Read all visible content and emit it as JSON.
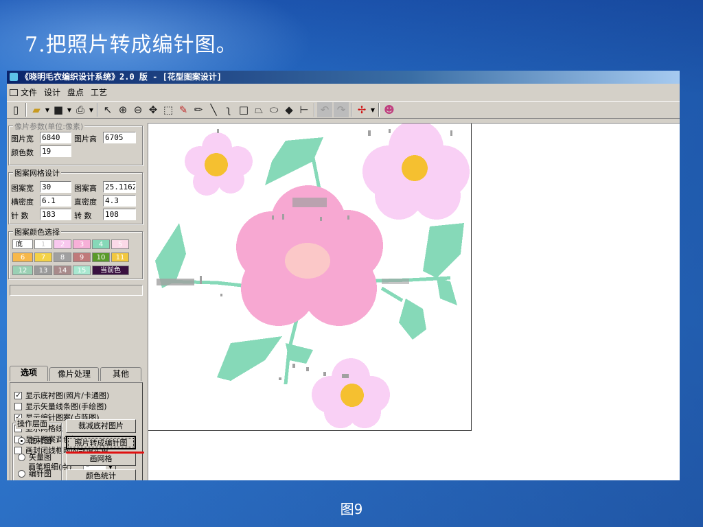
{
  "slide": {
    "title": "7.把照片转成编针图。",
    "caption": "图9"
  },
  "window": {
    "title": "《晓明毛衣编织设计系统》2.0 版 - [花型图案设计]",
    "menu": [
      "文件",
      "设计",
      "盘点",
      "工艺"
    ]
  },
  "toolbar": {
    "icons": [
      "new-icon",
      "open-icon",
      "save-icon",
      "print-icon",
      "pointer-icon",
      "zoom-in-icon",
      "zoom-out-icon",
      "move-icon",
      "select-rect-icon",
      "fill-icon",
      "pencil-icon",
      "line-icon",
      "curve-icon",
      "rect-icon",
      "polygon-icon",
      "ellipse-icon",
      "eraser-icon",
      "cross-icon",
      "undo-icon",
      "redo-icon",
      "mirror-icon",
      "person-icon"
    ]
  },
  "photo_params": {
    "group_title": "像片参数(单位:像素)",
    "width_label": "图片宽",
    "width_value": "6840",
    "height_label": "图片高",
    "height_value": "6705",
    "colors_label": "颜色数",
    "colors_value": "19"
  },
  "grid_design": {
    "group_title": "图案网格设计",
    "pattern_width_label": "图案宽",
    "pattern_width_value": "30",
    "pattern_height_label": "图案高",
    "pattern_height_value": "25.1162",
    "h_density_label": "横密度",
    "h_density_value": "6.1",
    "v_density_label": "直密度",
    "v_density_value": "4.3",
    "stitches_label": "针  数",
    "stitches_value": "183",
    "rows_label": "转  数",
    "rows_value": "108"
  },
  "color_select": {
    "group_title": "图案颜色选择",
    "base_label": "底",
    "swatches": [
      {
        "label": "1",
        "color": "#ffffff",
        "text": "#cccccc"
      },
      {
        "label": "2",
        "color": "#f9c8ef",
        "text": "#ffffff"
      },
      {
        "label": "3",
        "color": "#f7b0d8",
        "text": "#ffffff"
      },
      {
        "label": "4",
        "color": "#86d9b8",
        "text": "#ffffff"
      },
      {
        "label": "5",
        "color": "#fbd9e8",
        "text": "#ffffff"
      },
      {
        "label": "6",
        "color": "#f7b84a",
        "text": "#ffffff"
      },
      {
        "label": "7",
        "color": "#f4d246",
        "text": "#ffffff"
      },
      {
        "label": "8",
        "color": "#a0a0a0",
        "text": "#ffffff"
      },
      {
        "label": "9",
        "color": "#c07a7a",
        "text": "#ffffff"
      },
      {
        "label": "10",
        "color": "#5a9a2a",
        "text": "#ffffff"
      },
      {
        "label": "11",
        "color": "#f2c840",
        "text": "#ffffff"
      },
      {
        "label": "12",
        "color": "#9ad0b4",
        "text": "#ffffff"
      },
      {
        "label": "13",
        "color": "#9a9a9a",
        "text": "#ffffff"
      },
      {
        "label": "14",
        "color": "#a88a8a",
        "text": "#ffffff"
      },
      {
        "label": "15",
        "color": "#a8e8d0",
        "text": "#ffffff"
      }
    ],
    "current_label": "当前色",
    "current_color": "#3a1040"
  },
  "tabs": [
    {
      "label": "选项",
      "active": true
    },
    {
      "label": "像片处理",
      "active": false
    },
    {
      "label": "其他",
      "active": false
    }
  ],
  "options": [
    {
      "label": "显示底衬图(照片/卡通图)",
      "checked": true
    },
    {
      "label": "显示矢量线条图(手绘图)",
      "checked": false
    },
    {
      "label": "显示编针图案(点阵图)",
      "checked": true
    },
    {
      "label": "显示网格线",
      "checked": false
    },
    {
      "label": "显示图案调色板",
      "checked": false
    },
    {
      "label": "画封闭线框时内部填实色",
      "checked": false
    }
  ],
  "brush": {
    "label": "画笔粗细(点)",
    "value": "1"
  },
  "layers": {
    "group_title": "操作层面",
    "items": [
      {
        "label": "底衬图",
        "selected": true
      },
      {
        "label": "矢量图",
        "selected": false
      },
      {
        "label": "编针图",
        "selected": false
      }
    ]
  },
  "buttons": {
    "crop": "裁减底衬图片",
    "convert": "照片转成编针图",
    "draw_grid": "画网格",
    "color_stats": "颜色统计"
  },
  "colors": {
    "petal_light": "#f9d0f5",
    "petal_pink": "#f7a8d2",
    "petal_center": "#fbc8c8",
    "leaf_green": "#86d9b8",
    "yellow_center": "#f5c030",
    "gray_noise": "#a0a0a0"
  }
}
